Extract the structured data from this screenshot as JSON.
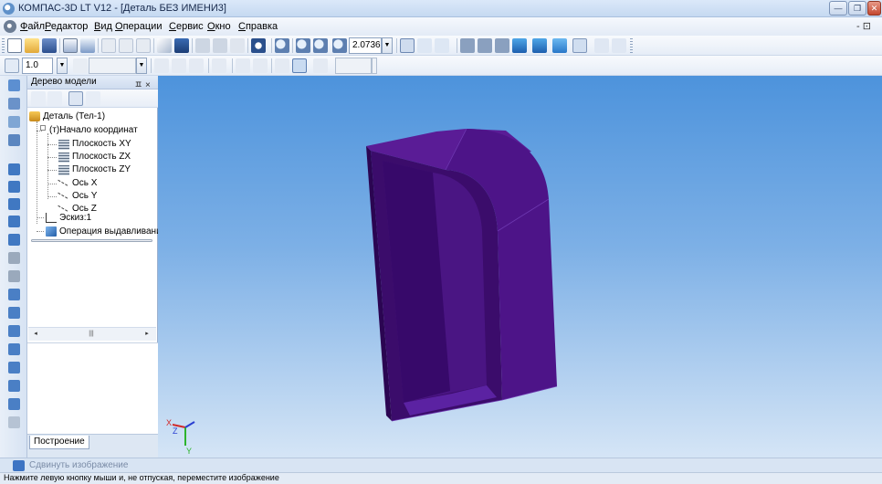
{
  "window": {
    "title": "КОМПАС-3D LT V12 - [Деталь БЕЗ ИМЕНИ3]",
    "controls": {
      "minimize": "—",
      "maximize": "❐",
      "close": "✕"
    }
  },
  "menubar": {
    "items": [
      "Файл",
      "Редактор",
      "Вид",
      "Операции",
      "Сервис",
      "Окно",
      "Справка"
    ],
    "mdi_controls": "- ⊡"
  },
  "toolbar_main": {
    "zoom_value": "2.0736"
  },
  "toolbar_second": {
    "step_value": "1.0"
  },
  "tree_panel": {
    "title": "Дерево модели",
    "header_controls": "ㅍ ×",
    "nodes": [
      {
        "label": "Деталь (Тел-1)",
        "icon": "part-icon"
      },
      {
        "label": "(т)Начало координат",
        "icon": "origin-icon"
      },
      {
        "label": "Плоскость XY",
        "icon": "plane-icon"
      },
      {
        "label": "Плоскость ZX",
        "icon": "plane-icon"
      },
      {
        "label": "Плоскость ZY",
        "icon": "plane-icon"
      },
      {
        "label": "Ось X",
        "icon": "axis-icon"
      },
      {
        "label": "Ось Y",
        "icon": "axis-icon"
      },
      {
        "label": "Ось Z",
        "icon": "axis-icon"
      },
      {
        "label": "Эскиз:1",
        "icon": "sketch-icon"
      },
      {
        "label": "Операция выдавливания",
        "icon": "extrude-icon"
      }
    ],
    "scrollbar": {
      "left": "◂",
      "right": "▸",
      "thumb": "|||"
    },
    "tabs": [
      "Построение"
    ]
  },
  "viewport": {
    "model_color": "#47127b",
    "triad": {
      "x_label": "X",
      "y_label": "Y",
      "z_label": "Z"
    }
  },
  "command_bar": {
    "label": "Сдвинуть изображение"
  },
  "status": {
    "text": "Нажмите левую кнопку мыши и, не отпуская, переместите изображение"
  }
}
